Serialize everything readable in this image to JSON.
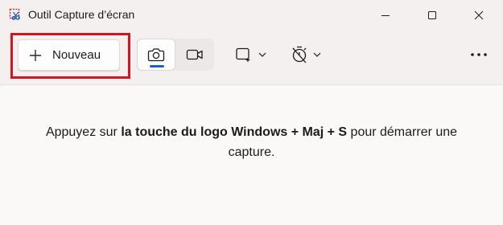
{
  "window": {
    "title": "Outil Capture d’écran",
    "app_icon": "snipping-tool-icon",
    "controls": [
      "minimize-icon",
      "maximize-icon",
      "close-icon"
    ]
  },
  "toolbar": {
    "new_label": "Nouveau",
    "new_icon": "plus-icon",
    "highlight_color": "#d6141f",
    "modes": [
      {
        "name": "photo",
        "icon": "camera-icon",
        "selected": true
      },
      {
        "name": "video",
        "icon": "video-camera-icon",
        "selected": false
      }
    ],
    "shape_icon": "rectangle-snip-icon",
    "timer_icon": "no-timer-icon",
    "more_icon": "more-horizontal-icon",
    "accent_color": "#1565c0"
  },
  "content": {
    "hint_part1": "Appuyez sur ",
    "hint_bold": "la touche du logo Windows + Maj + S",
    "hint_part2": " pour démarrer une",
    "hint_line2": "capture."
  }
}
